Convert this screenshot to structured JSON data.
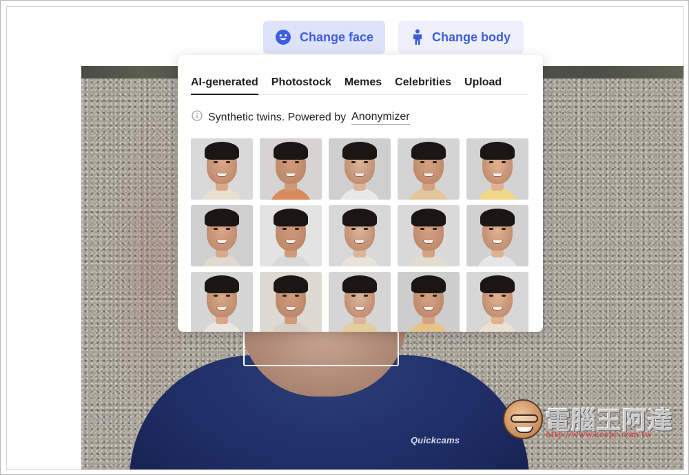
{
  "toolbar": {
    "change_face_label": "Change face",
    "change_body_label": "Change body",
    "accent_color": "#3f5de2",
    "change_face_icon": "smiley-face-icon",
    "change_body_icon": "person-figure-icon"
  },
  "popup": {
    "tabs": [
      {
        "label": "AI-generated",
        "active": true
      },
      {
        "label": "Photostock",
        "active": false
      },
      {
        "label": "Memes",
        "active": false
      },
      {
        "label": "Celebrities",
        "active": false
      },
      {
        "label": "Upload",
        "active": false
      }
    ],
    "info_icon": "info-circle-icon",
    "synthetic_text": "Synthetic twins. Powered by",
    "powered_by": "Anonymizer",
    "face_grid": {
      "rows": 3,
      "columns": 5,
      "thumbnails": [
        {
          "bg": "#d9d9d9",
          "shirt": "#e8e0cf"
        },
        {
          "bg": "#d6d4d2",
          "shirt": "#d98b5b"
        },
        {
          "bg": "#cfcfcf",
          "shirt": "#e9e9e9"
        },
        {
          "bg": "#d4d4d4",
          "shirt": "#e2c79a"
        },
        {
          "bg": "#d3d3d3",
          "shirt": "#f0d98a"
        },
        {
          "bg": "#cfcfcf",
          "shirt": "#dedad2"
        },
        {
          "bg": "#e3e3e3",
          "shirt": "#d9d9d9"
        },
        {
          "bg": "#d8d8d8",
          "shirt": "#e7e2da"
        },
        {
          "bg": "#dadada",
          "shirt": "#e3ddd0"
        },
        {
          "bg": "#d1d1d1",
          "shirt": "#e6e6e6"
        },
        {
          "bg": "#d6d6d6",
          "shirt": "#e9e6df"
        },
        {
          "bg": "#ded9d2",
          "shirt": "#d8d0c2"
        },
        {
          "bg": "#d5d5d5",
          "shirt": "#e3ce9c"
        },
        {
          "bg": "#cdcdcd",
          "shirt": "#e4c487"
        },
        {
          "bg": "#d7d7d7",
          "shirt": "#e9e2d3"
        }
      ]
    }
  },
  "photo": {
    "shirt_logo": "Quickcams"
  },
  "watermark": {
    "title": "電腦王阿達",
    "url": "http://www.kocpc.com.tw"
  }
}
